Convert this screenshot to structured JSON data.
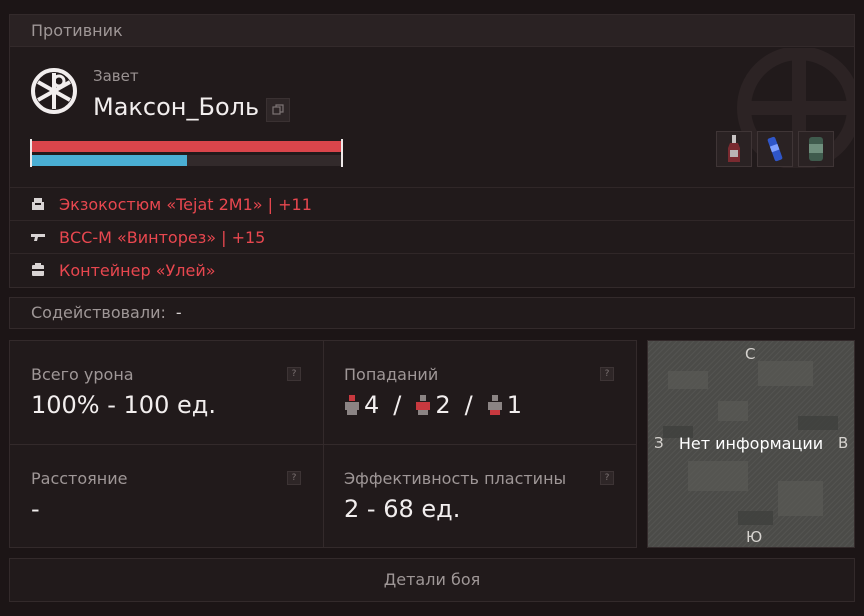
{
  "enemy": {
    "header": "Противник",
    "faction": "Завет",
    "name": "Максон_Боль",
    "health_fraction": 1.0,
    "armor_fraction": 0.5,
    "equipment": [
      {
        "icon": "armor-suit-icon",
        "text": "Экзокостюм «Tejat 2M1» | +11"
      },
      {
        "icon": "rifle-icon",
        "text": "ВСС-М «Винторез» | +15"
      },
      {
        "icon": "container-icon",
        "text": "Контейнер «Улей»"
      }
    ],
    "quick_items": [
      "bottle-icon",
      "syringe-icon",
      "canister-icon"
    ]
  },
  "assists": {
    "label": "Содействовали:",
    "value": "-"
  },
  "stats": {
    "total_damage": {
      "label": "Всего урона",
      "value": "100% - 100 ед."
    },
    "hits": {
      "label": "Попаданий",
      "head": "4",
      "body": "2",
      "legs": "1",
      "separator": "/"
    },
    "distance": {
      "label": "Расстояние",
      "value": "-"
    },
    "plate_efficiency": {
      "label": "Эффективность пластины",
      "value": "2 - 68 ед."
    },
    "help_icon": "?"
  },
  "map": {
    "north": "С",
    "south": "Ю",
    "west": "З",
    "east": "В",
    "no_info": "Нет информации"
  },
  "details_button": "Детали боя",
  "colors": {
    "health": "#d9454b",
    "armor": "#4aaed3",
    "equipment_text": "#e8474f"
  }
}
